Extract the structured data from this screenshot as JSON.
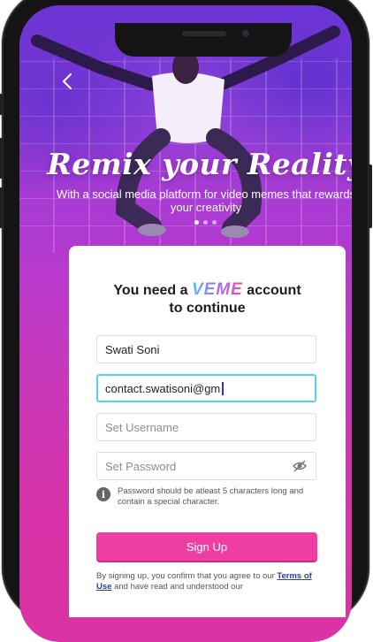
{
  "hero": {
    "back_icon": "chevron-left-icon",
    "title": "Remix your Reality",
    "subtitle": "With a social media platform for video memes that rewards your creativity",
    "carousel": {
      "count": 3,
      "active": 0
    }
  },
  "card": {
    "title_prefix": "You need a",
    "brand": "VEME",
    "title_suffix": "account",
    "title_line2": "to continue"
  },
  "form": {
    "name": {
      "value": "Swati Soni"
    },
    "email": {
      "value": "contact.swatisoni@gm"
    },
    "username": {
      "placeholder": "Set Username"
    },
    "password": {
      "placeholder": "Set Password",
      "icon": "eye-off-icon"
    },
    "hint_icon": "info-icon",
    "hint": "Password should be atleast 5 characters long and contain a special character.",
    "submit_label": "Sign Up"
  },
  "legal": {
    "prefix": "By signing up, you confirm that you agree to our",
    "terms_link": "Terms of Use",
    "suffix": "and have read and understood our"
  },
  "colors": {
    "accent": "#ee3ea4",
    "focus": "#58d3ee",
    "link": "#2a3cb5"
  }
}
